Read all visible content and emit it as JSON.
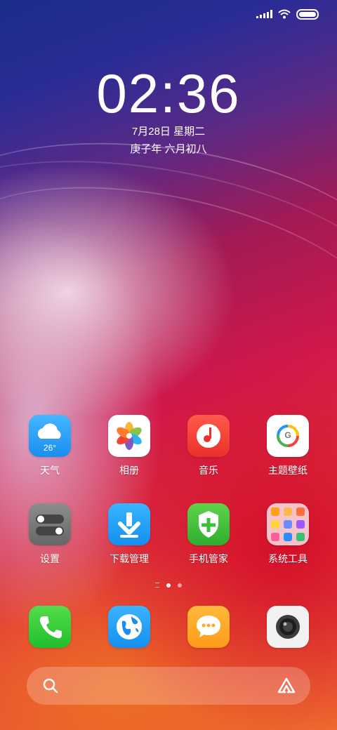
{
  "status_bar": {
    "icons": [
      "signal-icon",
      "wifi-icon",
      "battery-icon"
    ]
  },
  "clock": {
    "time": "02:36",
    "date": "7月28日 星期二",
    "lunar": "庚子年 六月初八"
  },
  "apps": [
    {
      "name": "天气",
      "icon": "weather-icon",
      "badge": "26°"
    },
    {
      "name": "相册",
      "icon": "gallery-icon"
    },
    {
      "name": "音乐",
      "icon": "music-icon"
    },
    {
      "name": "主题壁纸",
      "icon": "themes-icon",
      "badge": "G"
    },
    {
      "name": "设置",
      "icon": "settings-icon"
    },
    {
      "name": "下载管理",
      "icon": "download-icon"
    },
    {
      "name": "手机管家",
      "icon": "security-icon"
    },
    {
      "name": "系统工具",
      "icon": "folder-icon"
    }
  ],
  "page_indicator": {
    "pages": 2,
    "current": 1
  },
  "dock": [
    {
      "icon": "phone-icon"
    },
    {
      "icon": "browser-icon"
    },
    {
      "icon": "messages-icon"
    },
    {
      "icon": "camera-icon"
    }
  ],
  "search_bar": {
    "left_icon": "search-icon",
    "right_icon": "assistant-icon"
  }
}
